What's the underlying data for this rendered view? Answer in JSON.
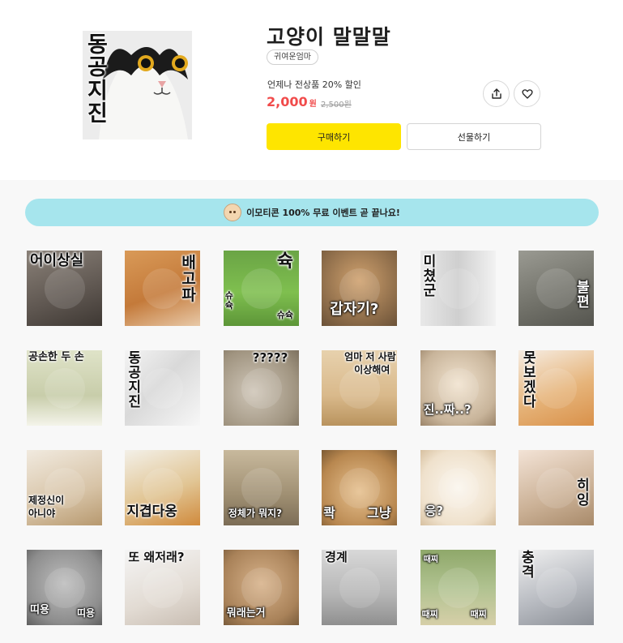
{
  "product": {
    "cover_text": "동공지진",
    "title": "고양이 말말말",
    "author": "귀여운엄마",
    "promo": "언제나 전상품 20% 할인",
    "price": "2,000",
    "price_unit": "원",
    "original_price": "2,500원",
    "buy_label": "구매하기",
    "gift_label": "선물하기",
    "share_icon": "share-icon",
    "like_icon": "heart-icon"
  },
  "banner": {
    "text": "이모티콘 100% 무료 이벤트 곧 끝나요!",
    "icon": "character-icon"
  },
  "colors": {
    "buy_button": "#fee500",
    "price": "#f14b4b",
    "banner": "#a6e5ed"
  },
  "stickers": [
    {
      "texts": [
        "어이상실"
      ]
    },
    {
      "texts": [
        "배고파"
      ]
    },
    {
      "texts": [
        "슉",
        "슈슉",
        "슈슉"
      ]
    },
    {
      "texts": [
        "갑자기?"
      ]
    },
    {
      "texts": [
        "미쳤군"
      ]
    },
    {
      "texts": [
        "불편"
      ]
    },
    {
      "texts": [
        "공손한 두 손"
      ]
    },
    {
      "texts": [
        "동공지진"
      ]
    },
    {
      "texts": [
        "?????"
      ]
    },
    {
      "texts": [
        "엄마 저 사람",
        "이상해여"
      ]
    },
    {
      "texts": [
        "진..짜..?"
      ]
    },
    {
      "texts": [
        "못보겠다"
      ]
    },
    {
      "texts": [
        "제정신이",
        "아니야"
      ]
    },
    {
      "texts": [
        "지겹다옹"
      ]
    },
    {
      "texts": [
        "정체가 뭐지?"
      ]
    },
    {
      "texts": [
        "콱",
        "그냥"
      ]
    },
    {
      "texts": [
        "응?"
      ]
    },
    {
      "texts": [
        "히잉"
      ]
    },
    {
      "texts": [
        "띠용",
        "띠용"
      ]
    },
    {
      "texts": [
        "또 왜저래?"
      ]
    },
    {
      "texts": [
        "뭐래는거"
      ]
    },
    {
      "texts": [
        "경계"
      ]
    },
    {
      "texts": [
        "때찌",
        "때찌",
        "때찌"
      ]
    },
    {
      "texts": [
        "충격"
      ]
    }
  ]
}
